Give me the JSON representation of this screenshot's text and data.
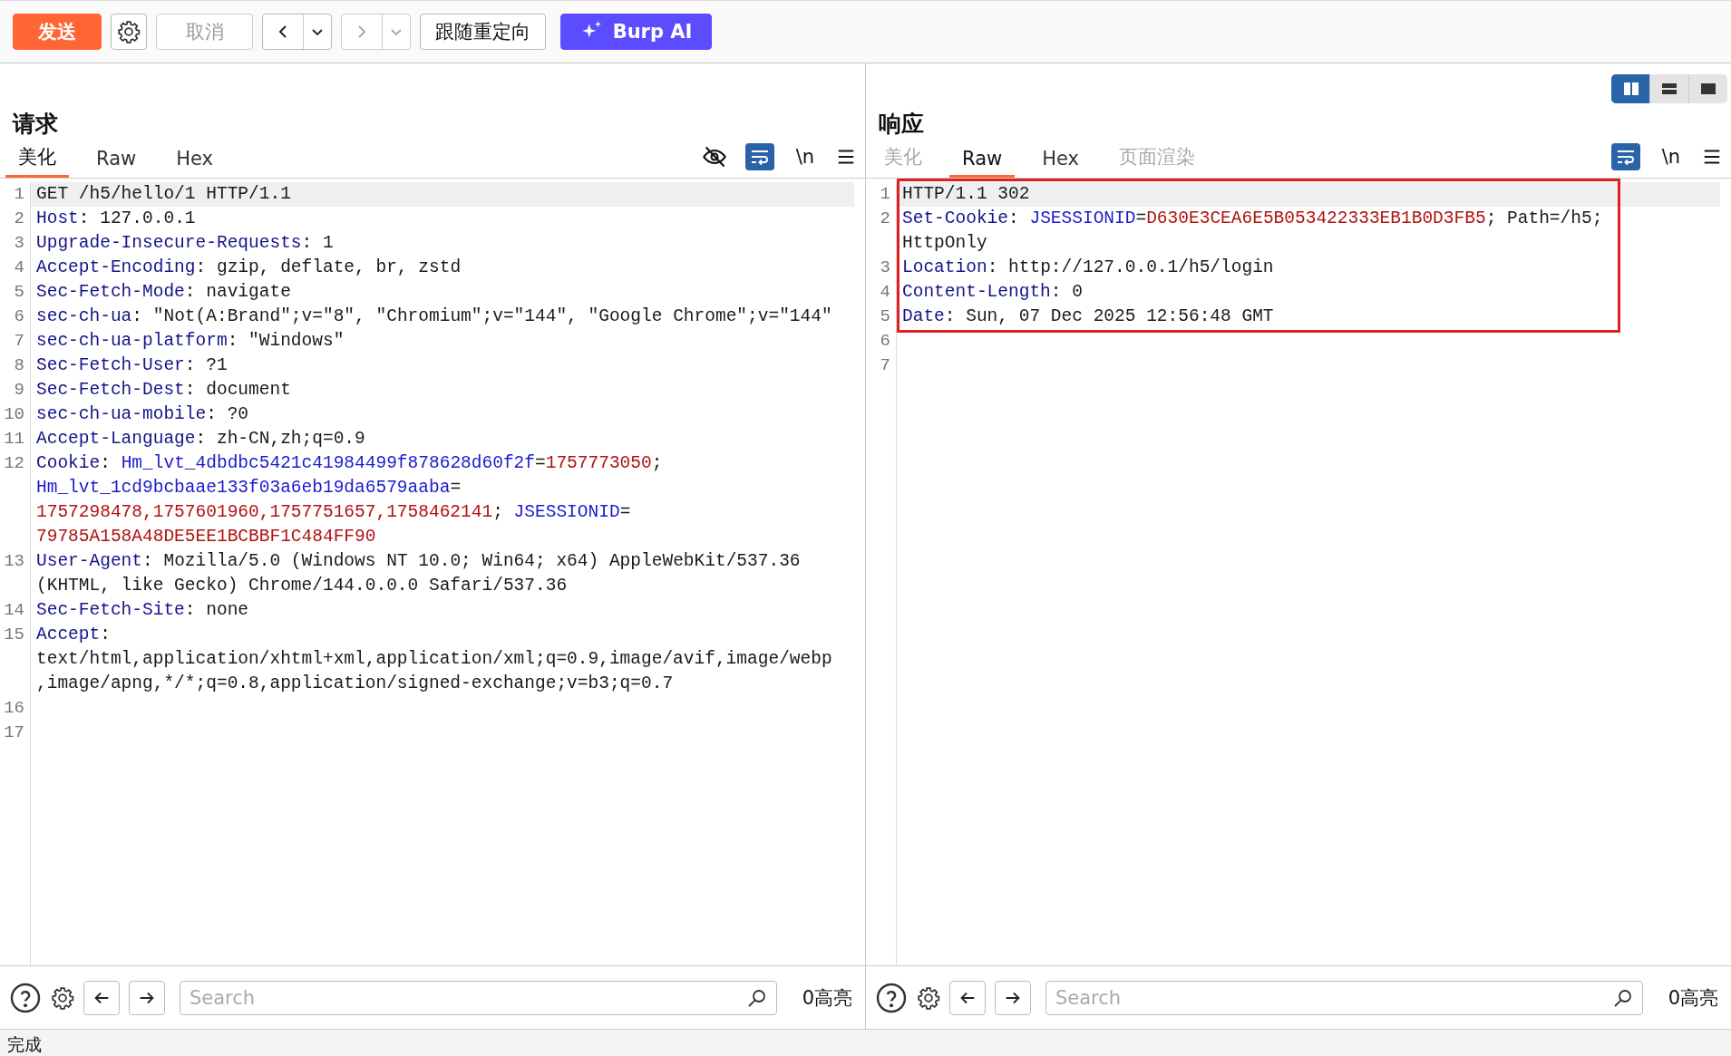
{
  "toolbar": {
    "send": "发送",
    "cancel": {
      "label": "取消",
      "disabled": true
    },
    "back": {
      "disabled": false
    },
    "forward": {
      "disabled": true
    },
    "follow_redirect": "跟随重定向",
    "burp_ai": "Burp AI"
  },
  "layout_toggle": [
    {
      "kind": "columns",
      "selected": true
    },
    {
      "kind": "rows",
      "selected": false
    },
    {
      "kind": "single",
      "selected": false
    }
  ],
  "request": {
    "title": "请求",
    "tabs": [
      {
        "label": "美化",
        "selected": true,
        "disabled": false
      },
      {
        "label": "Raw",
        "selected": false,
        "disabled": false
      },
      {
        "label": "Hex",
        "selected": false,
        "disabled": false
      }
    ],
    "tools": [
      {
        "kind": "hide",
        "on": false
      },
      {
        "kind": "wrap",
        "on": true
      },
      {
        "kind": "newline",
        "label": "\\n",
        "on": false
      },
      {
        "kind": "menu"
      }
    ],
    "lines": [
      {
        "number": "1",
        "current": true,
        "rows": [
          {
            "parts": [
              {
                "text": "GET /h5/hello/1 HTTP/1.1",
                "kind": "plain"
              }
            ]
          }
        ]
      },
      {
        "number": "2",
        "current": false,
        "rows": [
          {
            "parts": [
              {
                "text": "Host",
                "kind": "key"
              },
              {
                "text": ": 127.0.0.1",
                "kind": "plain"
              }
            ]
          }
        ]
      },
      {
        "number": "3",
        "current": false,
        "rows": [
          {
            "parts": [
              {
                "text": "Upgrade-Insecure-Requests",
                "kind": "key"
              },
              {
                "text": ": 1",
                "kind": "plain"
              }
            ]
          }
        ]
      },
      {
        "number": "4",
        "current": false,
        "rows": [
          {
            "parts": [
              {
                "text": "Accept-Encoding",
                "kind": "key"
              },
              {
                "text": ": gzip, deflate, br, zstd",
                "kind": "plain"
              }
            ]
          }
        ]
      },
      {
        "number": "5",
        "current": false,
        "rows": [
          {
            "parts": [
              {
                "text": "Sec-Fetch-Mode",
                "kind": "key"
              },
              {
                "text": ": navigate",
                "kind": "plain"
              }
            ]
          }
        ]
      },
      {
        "number": "6",
        "current": false,
        "rows": [
          {
            "parts": [
              {
                "text": "sec-ch-ua",
                "kind": "key"
              },
              {
                "text": ": \"Not(A:Brand\";v=\"8\", \"Chromium\";v=\"144\", \"Google Chrome\";v=\"144\"",
                "kind": "plain"
              }
            ]
          }
        ]
      },
      {
        "number": "7",
        "current": false,
        "rows": [
          {
            "parts": [
              {
                "text": "sec-ch-ua-platform",
                "kind": "key"
              },
              {
                "text": ": \"Windows\"",
                "kind": "plain"
              }
            ]
          }
        ]
      },
      {
        "number": "8",
        "current": false,
        "rows": [
          {
            "parts": [
              {
                "text": "Sec-Fetch-User",
                "kind": "key"
              },
              {
                "text": ": ?1",
                "kind": "plain"
              }
            ]
          }
        ]
      },
      {
        "number": "9",
        "current": false,
        "rows": [
          {
            "parts": [
              {
                "text": "Sec-Fetch-Dest",
                "kind": "key"
              },
              {
                "text": ": document",
                "kind": "plain"
              }
            ]
          }
        ]
      },
      {
        "number": "10",
        "current": false,
        "rows": [
          {
            "parts": [
              {
                "text": "sec-ch-ua-mobile",
                "kind": "key"
              },
              {
                "text": ": ?0",
                "kind": "plain"
              }
            ]
          }
        ]
      },
      {
        "number": "11",
        "current": false,
        "rows": [
          {
            "parts": [
              {
                "text": "Accept-Language",
                "kind": "key"
              },
              {
                "text": ": zh-CN,zh;q=0.9",
                "kind": "plain"
              }
            ]
          }
        ]
      },
      {
        "number": "12",
        "current": false,
        "rows": [
          {
            "parts": [
              {
                "text": "Cookie",
                "kind": "key"
              },
              {
                "text": ": ",
                "kind": "plain"
              },
              {
                "text": "Hm_lvt_4dbdbc5421c41984499f878628d60f2f",
                "kind": "name"
              },
              {
                "text": "=",
                "kind": "plain"
              },
              {
                "text": "1757773050",
                "kind": "value"
              },
              {
                "text": ";",
                "kind": "plain"
              }
            ]
          },
          {
            "parts": [
              {
                "text": "Hm_lvt_1cd9bcbaae133f03a6eb19da6579aaba",
                "kind": "name"
              },
              {
                "text": "=",
                "kind": "plain"
              }
            ]
          },
          {
            "parts": [
              {
                "text": "1757298478,1757601960,1757751657,1758462141",
                "kind": "value"
              },
              {
                "text": "; ",
                "kind": "plain"
              },
              {
                "text": "JSESSIONID",
                "kind": "name"
              },
              {
                "text": "=",
                "kind": "plain"
              }
            ]
          },
          {
            "parts": [
              {
                "text": "79785A158A48DE5EE1BCBBF1C484FF90",
                "kind": "value"
              }
            ]
          }
        ]
      },
      {
        "number": "13",
        "current": false,
        "rows": [
          {
            "parts": [
              {
                "text": "User-Agent",
                "kind": "key"
              },
              {
                "text": ": Mozilla/5.0 (Windows NT 10.0; Win64; x64) AppleWebKit/537.36",
                "kind": "plain"
              }
            ]
          },
          {
            "parts": [
              {
                "text": "(KHTML, like Gecko) Chrome/144.0.0.0 Safari/537.36",
                "kind": "plain"
              }
            ]
          }
        ]
      },
      {
        "number": "14",
        "current": false,
        "rows": [
          {
            "parts": [
              {
                "text": "Sec-Fetch-Site",
                "kind": "key"
              },
              {
                "text": ": none",
                "kind": "plain"
              }
            ]
          }
        ]
      },
      {
        "number": "15",
        "current": false,
        "rows": [
          {
            "parts": [
              {
                "text": "Accept",
                "kind": "key"
              },
              {
                "text": ":",
                "kind": "plain"
              }
            ]
          },
          {
            "parts": [
              {
                "text": "text/html,application/xhtml+xml,application/xml;q=0.9,image/avif,image/webp",
                "kind": "plain"
              }
            ]
          },
          {
            "parts": [
              {
                "text": ",image/apng,*/*;q=0.8,application/signed-exchange;v=b3;q=0.7",
                "kind": "plain"
              }
            ]
          }
        ]
      },
      {
        "number": "16",
        "current": false
      },
      {
        "number": "17",
        "current": false
      }
    ],
    "search": {
      "placeholder": "Search"
    },
    "highlights": "0高亮"
  },
  "response": {
    "title": "响应",
    "tabs": [
      {
        "label": "美化",
        "selected": false,
        "disabled": true
      },
      {
        "label": "Raw",
        "selected": true,
        "disabled": false
      },
      {
        "label": "Hex",
        "selected": false,
        "disabled": false
      },
      {
        "label": "页面渲染",
        "selected": false,
        "disabled": true
      }
    ],
    "tools": [
      {
        "kind": "wrap",
        "on": true
      },
      {
        "kind": "newline",
        "label": "\\n",
        "on": false
      },
      {
        "kind": "menu"
      }
    ],
    "lines": [
      {
        "number": "1",
        "current": true,
        "rows": [
          {
            "parts": [
              {
                "text": "HTTP/1.1 302",
                "kind": "plain"
              }
            ]
          }
        ]
      },
      {
        "number": "2",
        "current": false,
        "rows": [
          {
            "parts": [
              {
                "text": "Set-Cookie",
                "kind": "key"
              },
              {
                "text": ": ",
                "kind": "plain"
              },
              {
                "text": "JSESSIONID",
                "kind": "name"
              },
              {
                "text": "=",
                "kind": "plain"
              },
              {
                "text": "D630E3CEA6E5B053422333EB1B0D3FB5",
                "kind": "value"
              },
              {
                "text": "; Path=/h5;",
                "kind": "plain"
              }
            ]
          },
          {
            "parts": [
              {
                "text": "HttpOnly",
                "kind": "plain"
              }
            ]
          }
        ]
      },
      {
        "number": "3",
        "current": false,
        "rows": [
          {
            "parts": [
              {
                "text": "Location",
                "kind": "key"
              },
              {
                "text": ": http://127.0.0.1/h5/login",
                "kind": "plain"
              }
            ]
          }
        ]
      },
      {
        "number": "4",
        "current": false,
        "rows": [
          {
            "parts": [
              {
                "text": "Content-Length",
                "kind": "key"
              },
              {
                "text": ": 0",
                "kind": "plain"
              }
            ]
          }
        ]
      },
      {
        "number": "5",
        "current": false,
        "rows": [
          {
            "parts": [
              {
                "text": "Date",
                "kind": "key"
              },
              {
                "text": ": Sun, 07 Dec 2025 12:56:48 GMT",
                "kind": "plain"
              }
            ]
          }
        ]
      },
      {
        "number": "6",
        "current": false
      },
      {
        "number": "7",
        "current": false
      }
    ],
    "annotation": {
      "kind": "rectangle"
    },
    "search": {
      "placeholder": "Search"
    },
    "highlights": "0高亮"
  },
  "status_bar": "完成"
}
